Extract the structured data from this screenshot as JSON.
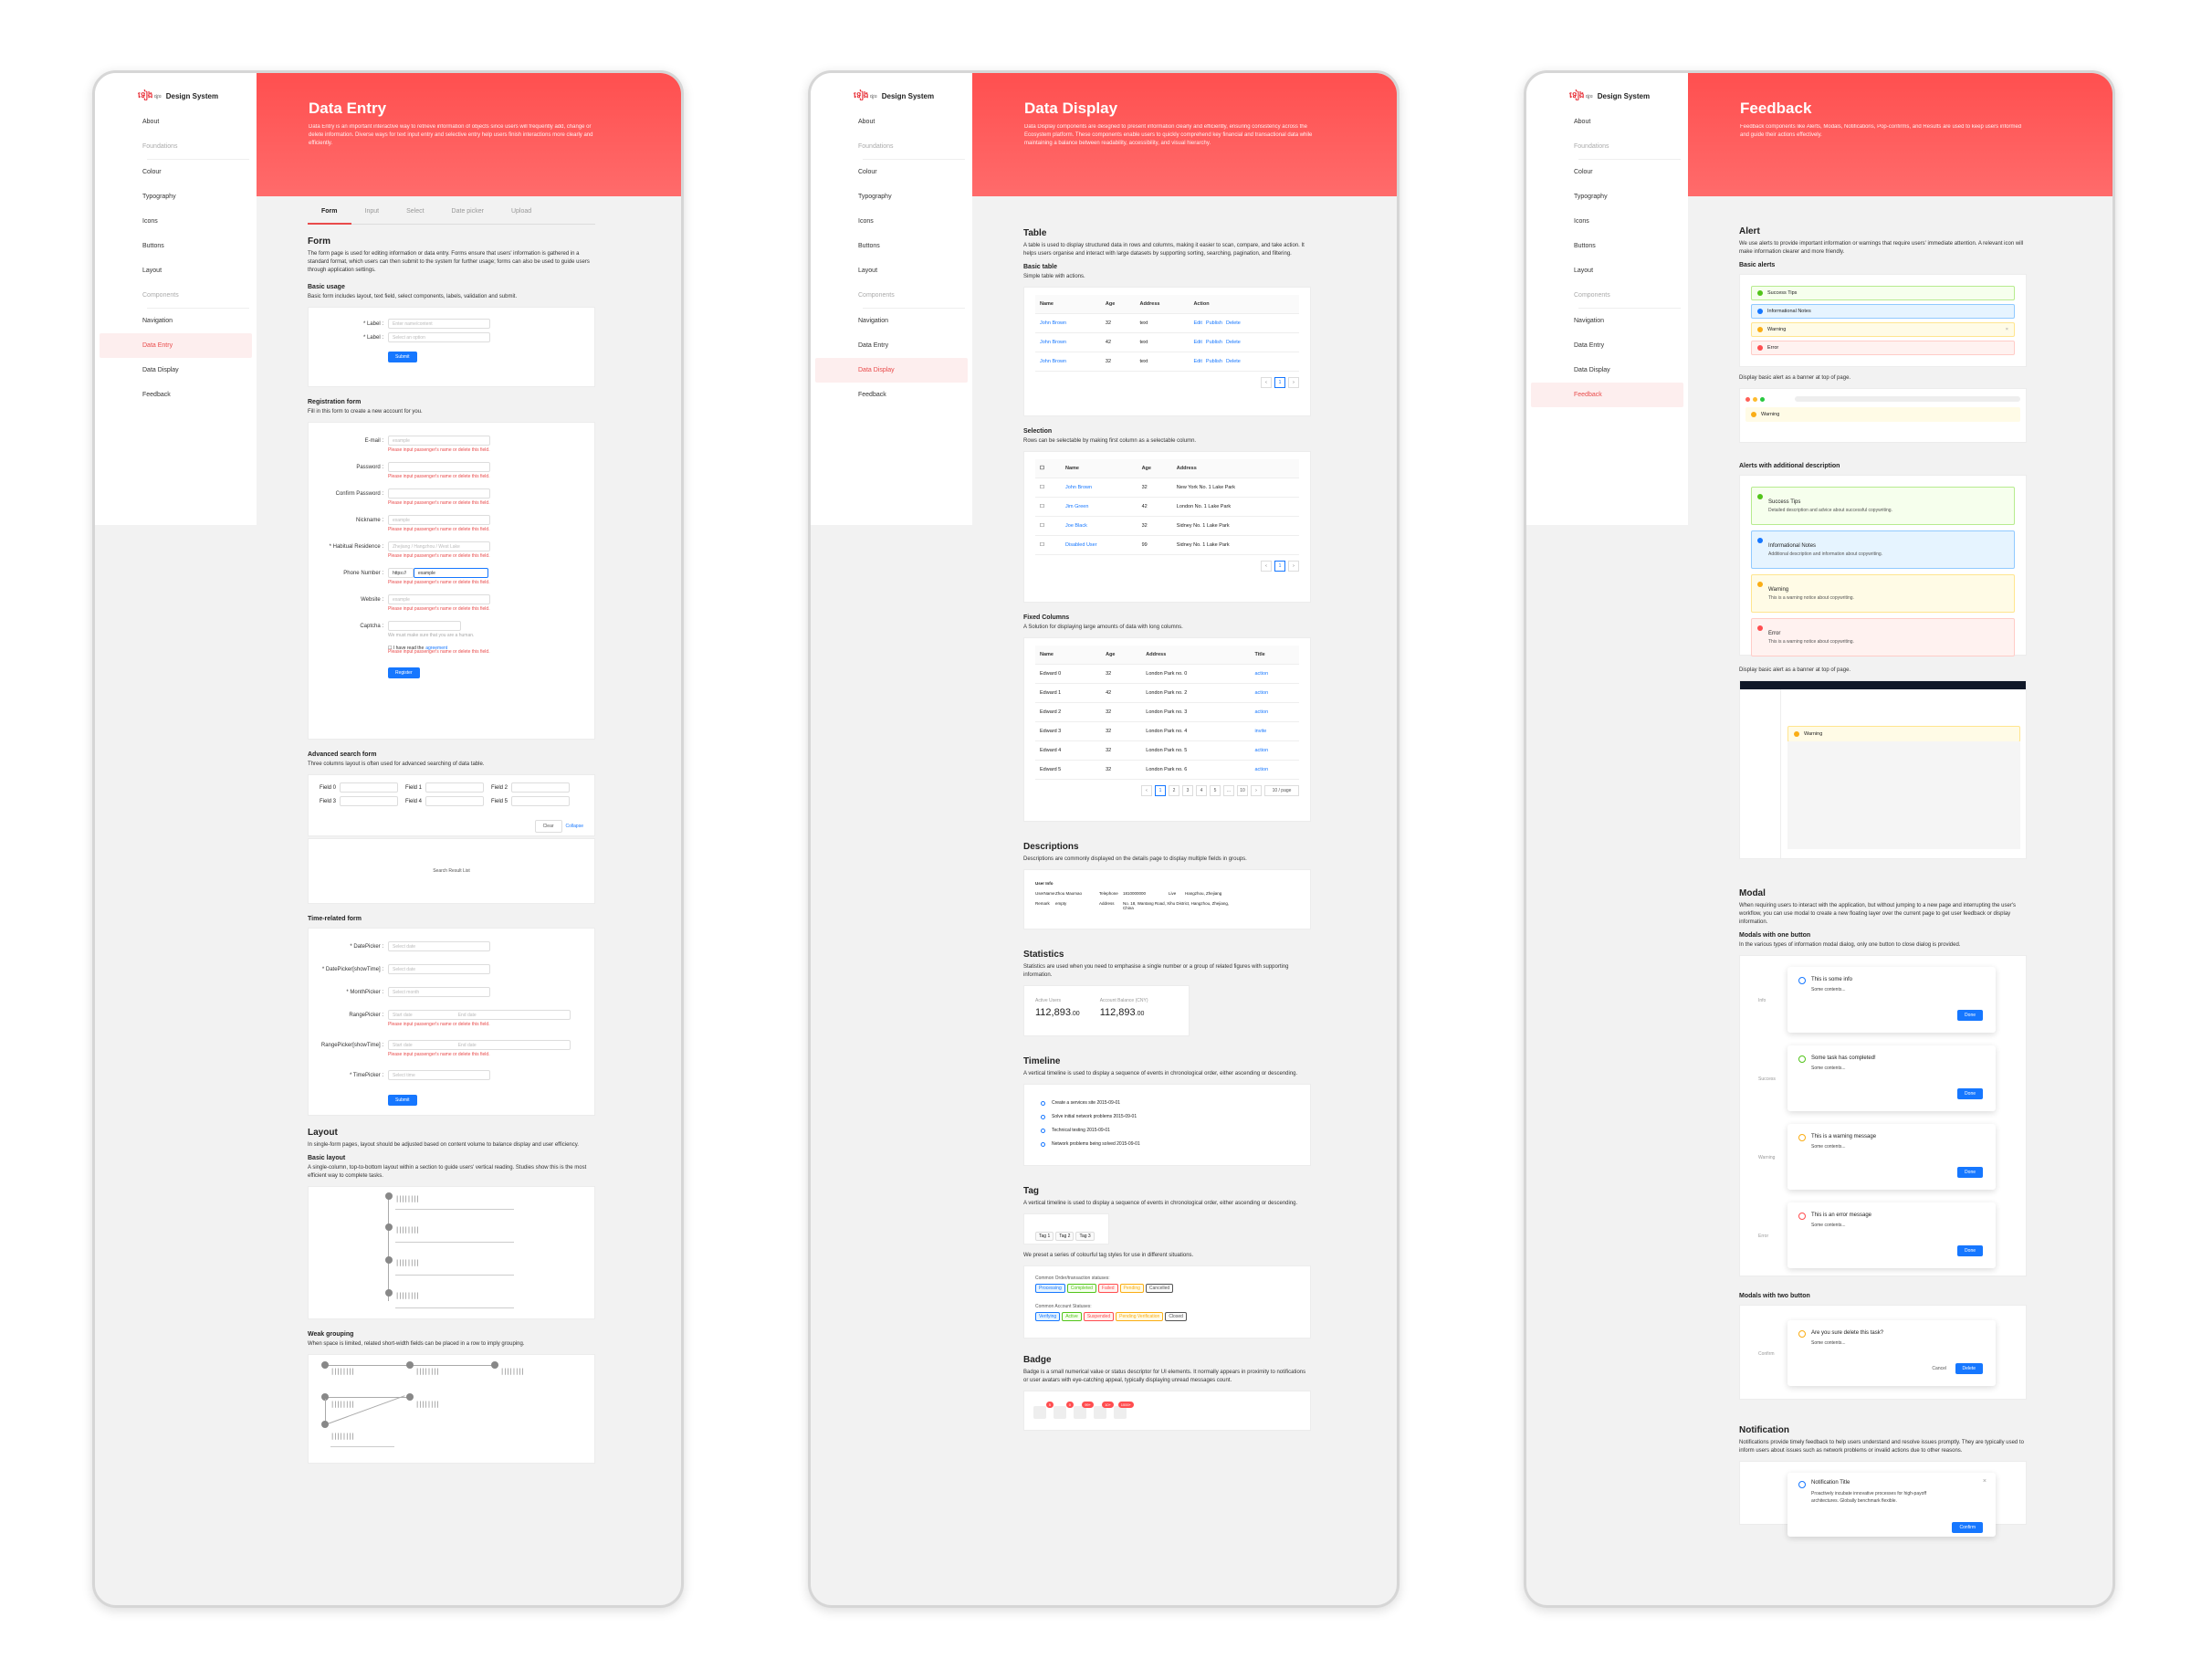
{
  "brand": {
    "mark": "ទៀង",
    "logotype": "ផ្សារ",
    "name": "Design System"
  },
  "nav": [
    "About",
    "Foundations",
    "Colour",
    "Typography",
    "Icons",
    "Buttons",
    "Layout",
    "Components",
    "Navigation",
    "Data Entry",
    "Data Display",
    "Feedback"
  ],
  "colors": {
    "accent": "#ff4f4f",
    "primary": "#1677ff",
    "success": "#52c41a",
    "warning": "#faad14",
    "error": "#ff4d4f"
  },
  "entry": {
    "title": "Data Entry",
    "desc": "Data Entry is an important interactive way to retrieve information of objects since users will frequently add, change or delete information. Diverse ways for text input entry and selective entry help users finish interactions more clearly and efficiently.",
    "tabs": [
      "Form",
      "Input",
      "Select",
      "Date picker",
      "Upload"
    ],
    "form_title": "Form",
    "form_desc": "The form page is used for editing information or data entry. Forms ensure that users' information is gathered in a standard format, which users can then submit to the system for further usage; forms can also be used to guide users through application settings.",
    "basic": {
      "title": "Basic usage",
      "desc": "Basic form includes layout, text field, select components, labels, validation and submit.",
      "label": "* Label :",
      "placeholder1": "Enter name/content",
      "placeholder2": "Select an option",
      "submit": "Submit"
    },
    "reg": {
      "title": "Registration form",
      "desc": "Fill in this form to create a new account for you.",
      "fields": [
        {
          "label": "E-mail :",
          "ph": "example"
        },
        {
          "label": "Password :",
          "ph": ""
        },
        {
          "label": "Confirm Password :",
          "ph": ""
        },
        {
          "label": "Nickname :",
          "ph": "example"
        },
        {
          "label": "* Habitual Residence :",
          "ph": "Zhejiang / Hangzhou / West Lake"
        },
        {
          "label": "Phone Number :",
          "ph": "example"
        },
        {
          "label": "Website :",
          "ph": "example"
        },
        {
          "label": "Captcha :",
          "ph": ""
        }
      ],
      "error": "Please input passenger's name or delete this field.",
      "captcha_note": "We must make sure that you are a human.",
      "agree": "I have read the",
      "agreement": "agreement",
      "register": "Register",
      "prefix": "https://"
    },
    "adv": {
      "title": "Advanced search form",
      "desc": "Three columns layout is often used for advanced searching of data table.",
      "fields": [
        "Field 0",
        "Field 1",
        "Field 2",
        "Field 3",
        "Field 4",
        "Field 5"
      ],
      "clear": "Clear",
      "collapse": "Collapse",
      "result": "Search Result List"
    },
    "time": {
      "title": "Time-related form",
      "rows": [
        {
          "label": "* DatePicker :",
          "ph": "Select date"
        },
        {
          "label": "* DatePicker[showTime] :",
          "ph": "Select date"
        },
        {
          "label": "* MonthPicker :",
          "ph": "Select month"
        },
        {
          "label": "RangePicker :",
          "ph": "Start date"
        },
        {
          "label": "RangePicker[showTime] :",
          "ph": "Start date"
        },
        {
          "label": "* TimePicker :",
          "ph": "Select time"
        }
      ],
      "end": "End date",
      "submit": "Submit"
    },
    "layout": {
      "title": "Layout",
      "desc": "In single-form pages, layout should be adjusted based on content volume to balance display and user efficiency.",
      "sub": "Basic layout",
      "sub_desc": "A single-column, top-to-bottom layout within a section to guide users' vertical reading. Studies show this is the most efficient way to complete tasks.",
      "placeholder": "||||||||"
    },
    "weak": {
      "title": "Weak grouping",
      "desc": "When space is limited, related short-width fields can be placed in a row to imply grouping."
    }
  },
  "display": {
    "title": "Data Display",
    "desc": "Data Display components are designed to present information clearly and efficiently, ensuring consistency across the Ecosystem platform. These components enable users to quickly comprehend key financial and transactional data while maintaining a balance between readability, accessibility, and visual hierarchy.",
    "table": {
      "title": "Table",
      "desc": "A table is used to display structured data in rows and columns, making it easier to scan, compare, and take action. It helps users organise and interact with large datasets by supporting sorting, searching, pagination, and filtering.",
      "sub": "Basic table",
      "sub_desc": "Simple table with actions.",
      "cols": [
        "Name",
        "Age",
        "Address",
        "Action"
      ],
      "rows": [
        [
          "John Brown",
          "32",
          "text"
        ],
        [
          "John Brown",
          "42",
          "text"
        ],
        [
          "John Brown",
          "32",
          "text"
        ]
      ],
      "actions": [
        "Edit",
        "Publish",
        "Delete"
      ]
    },
    "sel": {
      "title": "Selection",
      "desc": "Rows can be selectable by making first column as a selectable column.",
      "cols": [
        "Name",
        "Age",
        "Address"
      ],
      "rows": [
        [
          "John Brown",
          "32",
          "New York No. 1 Lake Park"
        ],
        [
          "Jim Green",
          "42",
          "London No. 1 Lake Park"
        ],
        [
          "Joe Black",
          "32",
          "Sidney No. 1 Lake Park"
        ],
        [
          "Disabled User",
          "99",
          "Sidney No. 1 Lake Park"
        ]
      ]
    },
    "fixed": {
      "title": "Fixed Columns",
      "desc": "A Solution for displaying large amounts of data with long columns.",
      "cols": [
        "Name",
        "Age",
        "Address",
        "Title"
      ],
      "rows": [
        [
          "Edward 0",
          "32",
          "London Park no. 0",
          "action"
        ],
        [
          "Edward 1",
          "42",
          "London Park no. 2",
          "action"
        ],
        [
          "Edward 2",
          "32",
          "London Park no. 3",
          "action"
        ],
        [
          "Edward 3",
          "32",
          "London Park no. 4",
          "invite"
        ],
        [
          "Edward 4",
          "32",
          "London Park no. 5",
          "action"
        ],
        [
          "Edward 5",
          "32",
          "London Park no. 6",
          "action"
        ]
      ],
      "pages": [
        "1",
        "2",
        "3",
        "4",
        "5",
        "...",
        "10"
      ],
      "page_size": "10 / page"
    },
    "desc2": {
      "title": "Descriptions",
      "desc": "Descriptions are commonly displayed on the details page to display multiple fields in groups.",
      "head": "User Info",
      "pairs": [
        [
          "UserName",
          "Zhou Maomao"
        ],
        [
          "Telephone",
          "1810000000"
        ],
        [
          "Live",
          "Hangzhou, Zhejiang"
        ],
        [
          "Remark",
          "empty"
        ],
        [
          "Address",
          "No. 18, Wantang Road, Xihu District, Hangzhou, Zhejiang, China"
        ]
      ]
    },
    "stats": {
      "title": "Statistics",
      "desc": "Statistics are used when you need to emphasise a single number or a group of related figures with supporting information.",
      "items": [
        {
          "label": "Active Users",
          "value": "112,893",
          "dec": ".00"
        },
        {
          "label": "Account Balance (CNY)",
          "value": "112,893",
          "dec": ".00"
        }
      ]
    },
    "timeline": {
      "title": "Timeline",
      "desc": "A vertical timeline is used to display a sequence of events in chronological order, either ascending or descending.",
      "items": [
        "Create a services site 2015-09-01",
        "Solve initial network problems 2015-09-01",
        "Technical testing 2015-09-01",
        "Network problems being solved 2015-09-01"
      ]
    },
    "tag": {
      "title": "Tag",
      "desc": "A vertical timeline is used to display a sequence of events in chronological order, either ascending or descending.",
      "basic": [
        "Tag 1",
        "Tag 2",
        "Tag 3"
      ],
      "preset": "We preset a series of colourful tag styles for use in different situations.",
      "g1": "Common Order/transaction statuses:",
      "t1": [
        "Processing",
        "Completed",
        "Failed",
        "Pending",
        "Cancelled"
      ],
      "g2": "Common Account Statuses:",
      "t2": [
        "Verifying",
        "Active",
        "Suspended",
        "Pending Verification",
        "Closed"
      ]
    },
    "badge": {
      "title": "Badge",
      "desc": "Badge is a small numerical value or status descriptor for UI elements. It normally appears in proximity to notifications or user avatars with eye-catching appeal, typically displaying unread messages count.",
      "counts": [
        "5",
        "0",
        "99+",
        "10+",
        "1000+"
      ]
    }
  },
  "feedback": {
    "title": "Feedback",
    "desc": "Feedback components like Alerts, Modals, Notifications, Pop-confirms, and Results are used to keep users informed and guide their actions effectively.",
    "alert": {
      "title": "Alert",
      "desc": "We use alerts to provide important information or warnings that require users' immediate attention. A relevant icon will make information clearer and more friendly.",
      "basic": "Basic alerts",
      "items": [
        "Success Tips",
        "Informational Notes",
        "Warning",
        "Error"
      ],
      "banner": "Display basic alert as a banner at top of page.",
      "warning": "Warning",
      "addl": "Alerts with additional description",
      "big": [
        {
          "t": "Success Tips",
          "d": "Detailed description and advice about successful copywriting."
        },
        {
          "t": "Informational Notes",
          "d": "Additional description and information about copywriting."
        },
        {
          "t": "Warning",
          "d": "This is a warning notice about copywriting."
        },
        {
          "t": "Error",
          "d": "This is a warning notice about copywriting."
        }
      ],
      "banner2": "Display basic alert as a banner at top of page."
    },
    "modal": {
      "title": "Modal",
      "desc": "When requiring users to interact with the application, but without jumping to a new page and interrupting the user's workflow, you can use modal to create a new floating layer over the current page to get user feedback or display information.",
      "one": "Modals with one button",
      "one_desc": "In the various types of information modal dialog, only one button to close dialog is provided.",
      "items": [
        {
          "lab": "Info",
          "t": "This is some info"
        },
        {
          "lab": "Success",
          "t": "Some task has completed!"
        },
        {
          "lab": "Warning",
          "t": "This is a warning message"
        },
        {
          "lab": "Error",
          "t": "This is an error message"
        }
      ],
      "contents": "Some contents...",
      "done": "Done",
      "two": "Modals with two button",
      "confirm_lab": "Confirm",
      "confirm_t": "Are you sure delete this task?",
      "cancel": "Cancel",
      "delete": "Delete"
    },
    "notif": {
      "title": "Notification",
      "desc": "Notifications provide timely feedback to help users understand and resolve issues promptly. They are typically used to inform users about issues such as network problems or invalid actions due to other reasons.",
      "n_title": "Notification Title",
      "n_body": "Proactively incubate innovative processes for high-payoff architectures. Globally benchmark flexible.",
      "n_btn": "Confirm"
    }
  }
}
